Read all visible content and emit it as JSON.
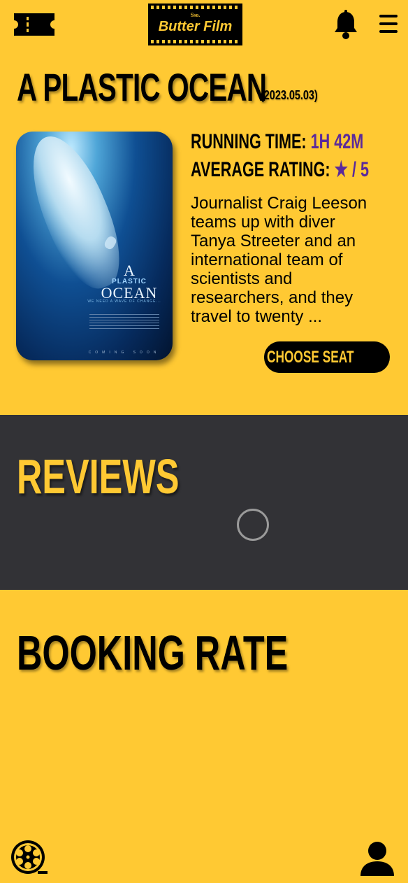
{
  "header": {
    "ticket_icon": "ticket-icon",
    "logo_small": "Sso.",
    "logo_name": "Butter Film",
    "bell_icon": "bell-icon",
    "menu_icon": "hamburger-menu-icon"
  },
  "movie": {
    "title": "A PLASTIC OCEAN",
    "release_date": "(2023.05.03)",
    "running_time_label": "RUNNING TIME:",
    "running_time_value": "1H 42M",
    "average_rating_label": "AVERAGE RATING:",
    "average_rating_value": "★ / 5",
    "description": " Journalist Craig Leeson\nteams up with diver\nTanya Streeter and an\ninternational team of\nscientists and\nresearchers, and they\ntravel to twenty ...",
    "choose_seat_label": "CHOOSE SEAT",
    "poster": {
      "title_a": "A",
      "title_plastic": "PLASTIC",
      "title_ocean": "OCEAN",
      "tagline": "WE NEED A WAVE OF CHANGE...",
      "coming_soon": "COMING SOON"
    }
  },
  "reviews": {
    "heading": "REVIEWS"
  },
  "booking": {
    "heading": "BOOKING RATE"
  },
  "bottom_nav": {
    "film_reel_icon": "film-reel-icon",
    "profile_icon": "user-profile-icon"
  },
  "colors": {
    "background": "#FFC933",
    "accent_purple": "#5B2A9B",
    "dark_section": "#323236",
    "black": "#000000"
  }
}
